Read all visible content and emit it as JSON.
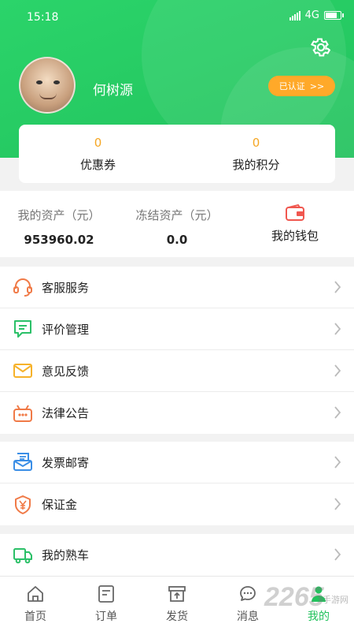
{
  "status_bar": {
    "time": "15:18",
    "network": "4G"
  },
  "profile": {
    "username": "何树源",
    "verified_label": "已认证",
    "verified_arrow": ">>"
  },
  "points": [
    {
      "value": "0",
      "label": "优惠券"
    },
    {
      "value": "0",
      "label": "我的积分"
    }
  ],
  "assets": {
    "my_assets": {
      "title": "我的资产（元）",
      "value": "953960.02"
    },
    "frozen_assets": {
      "title": "冻结资产（元）",
      "value": "0.0"
    },
    "wallet_label": "我的钱包"
  },
  "menu_groups": [
    {
      "items": [
        {
          "icon": "headset-icon",
          "label": "客服服务",
          "color": "#f07a47"
        },
        {
          "icon": "comment-icon",
          "label": "评价管理",
          "color": "#2bc068"
        },
        {
          "icon": "mail-icon",
          "label": "意见反馈",
          "color": "#f6b22a"
        },
        {
          "icon": "robot-icon",
          "label": "法律公告",
          "color": "#f07a47"
        }
      ]
    },
    {
      "items": [
        {
          "icon": "invoice-mail-icon",
          "label": "发票邮寄",
          "color": "#3a8ee6"
        },
        {
          "icon": "shield-yen-icon",
          "label": "保证金",
          "color": "#f07a47"
        }
      ]
    },
    {
      "items": [
        {
          "icon": "truck-icon",
          "label": "我的熟车",
          "color": "#2bc068"
        }
      ]
    }
  ],
  "tabs": [
    {
      "icon": "home-icon",
      "label": "首页",
      "active": false
    },
    {
      "icon": "order-icon",
      "label": "订单",
      "active": false
    },
    {
      "icon": "ship-icon",
      "label": "发货",
      "active": false
    },
    {
      "icon": "message-icon",
      "label": "消息",
      "active": false
    },
    {
      "icon": "person-icon",
      "label": "我的",
      "active": true
    }
  ],
  "watermark": {
    "brand": "2265",
    "sub": "手游网"
  },
  "colors": {
    "primary": "#22c25d",
    "accent": "#ffa929",
    "points": "#f5a623",
    "wallet": "#f0574f"
  }
}
